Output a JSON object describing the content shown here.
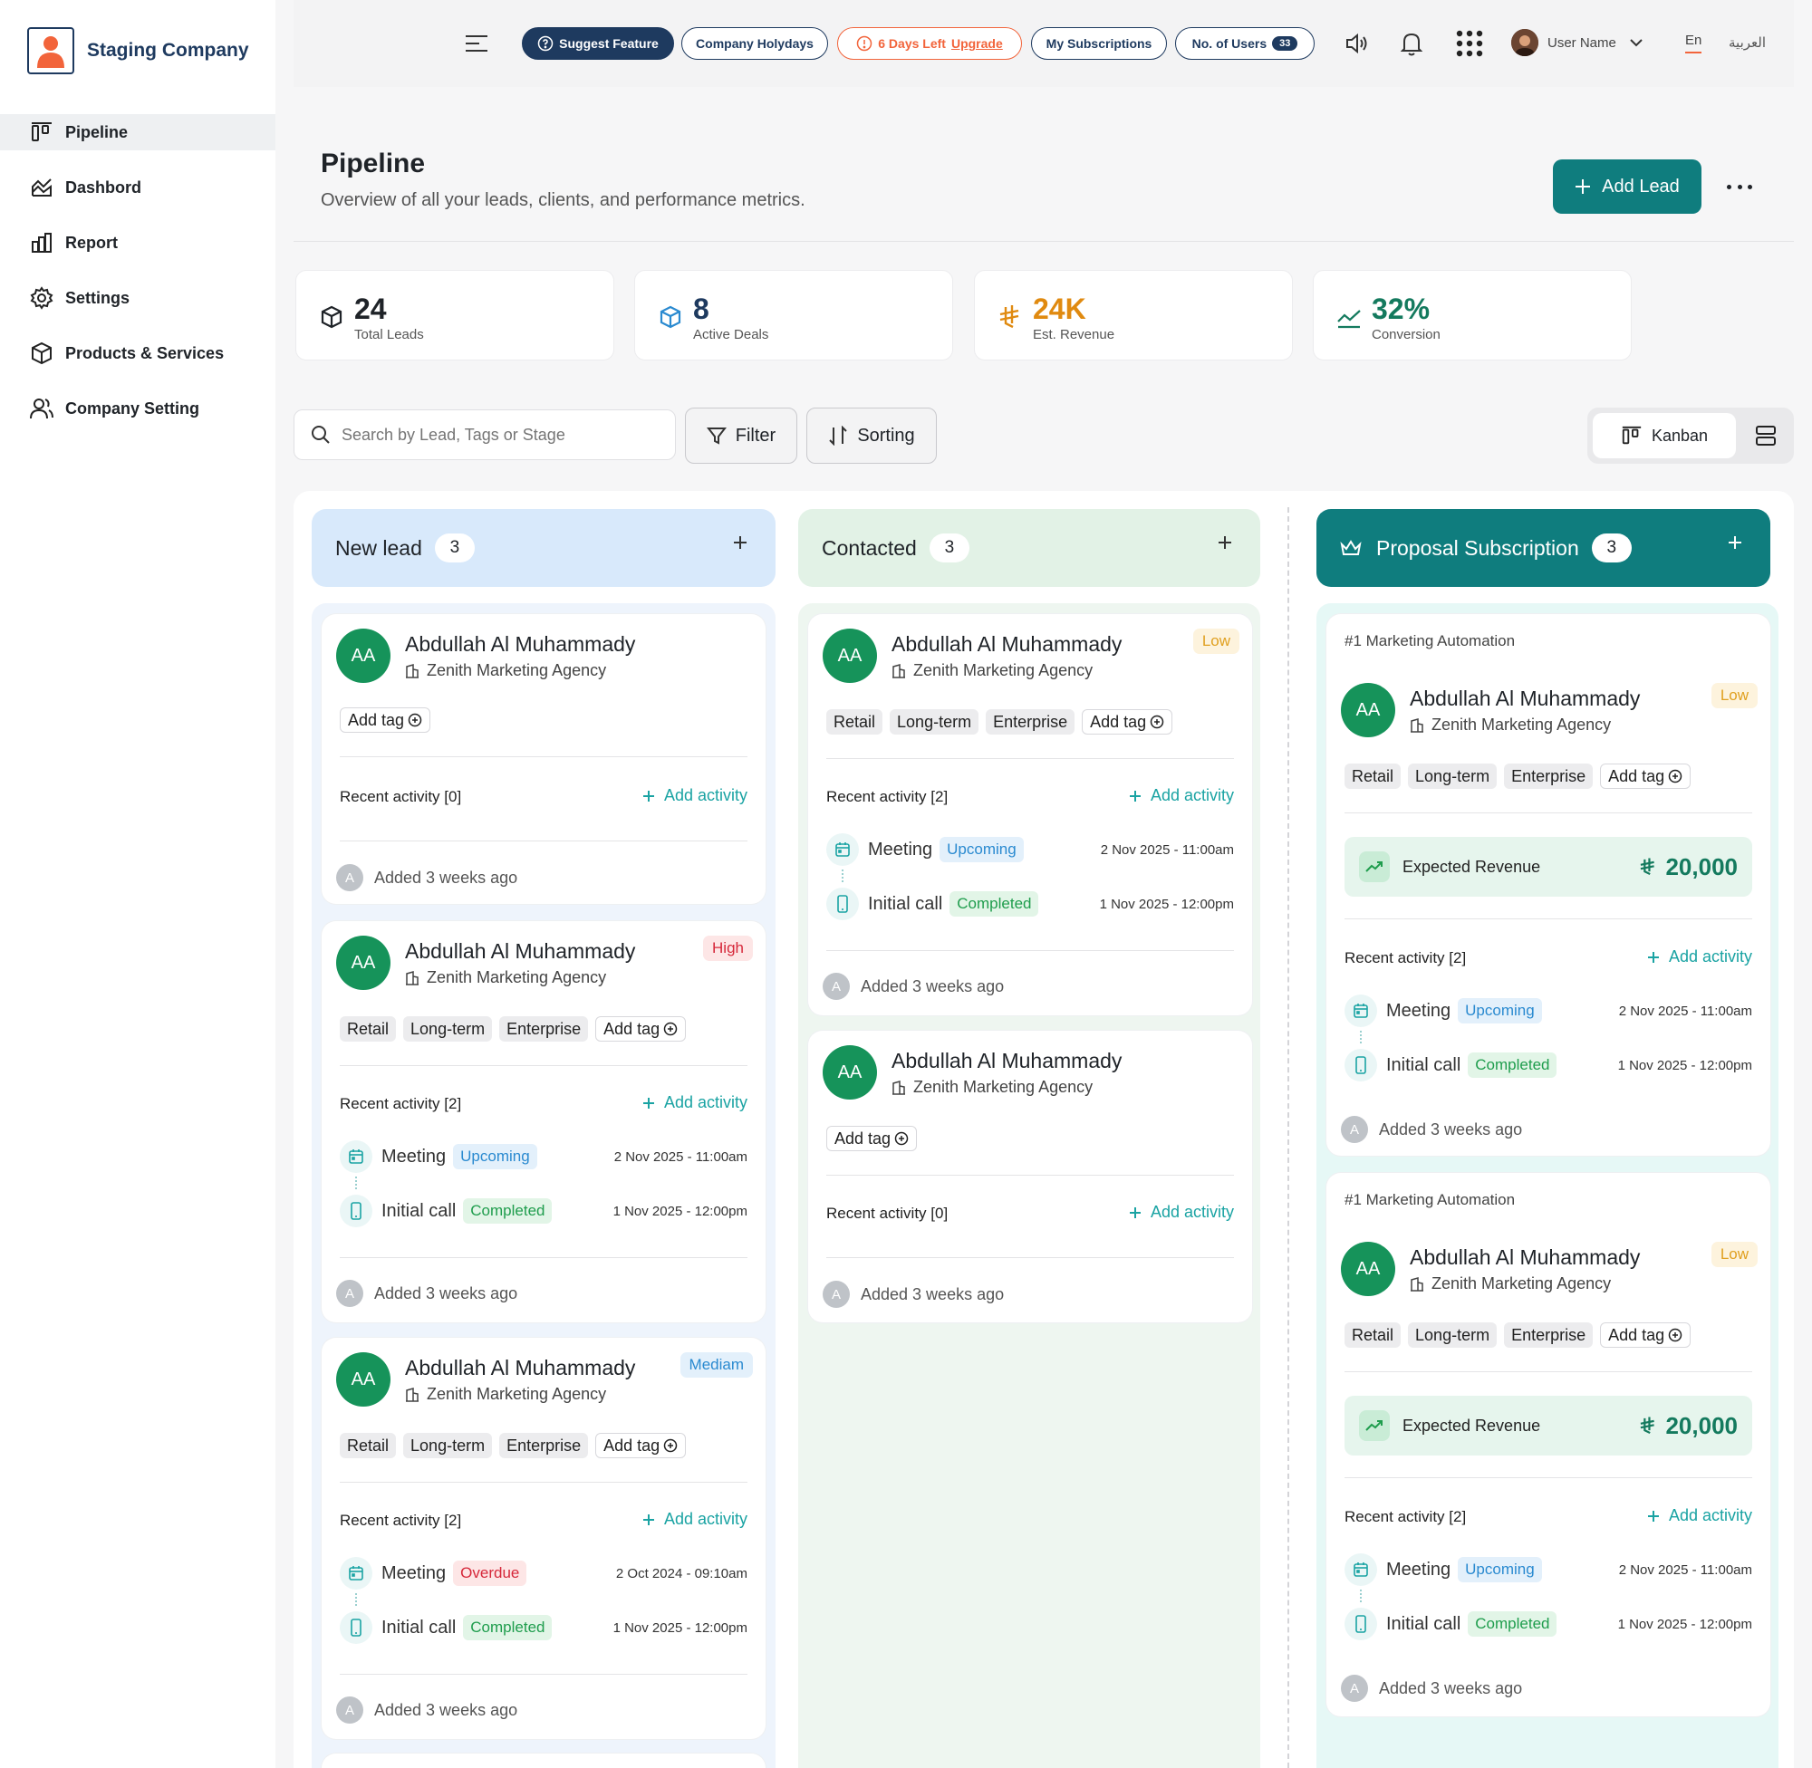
{
  "brand": {
    "name": "Staging Company"
  },
  "nav": [
    {
      "label": "Pipeline",
      "icon": "kanban-icon"
    },
    {
      "label": "Dashbord",
      "icon": "chart-area-icon"
    },
    {
      "label": "Report",
      "icon": "bar-chart-icon"
    },
    {
      "label": "Settings",
      "icon": "gear-icon"
    },
    {
      "label": "Products & Services",
      "icon": "box-icon"
    },
    {
      "label": "Company Setting",
      "icon": "users-icon"
    }
  ],
  "topbar": {
    "suggest": "Suggest Feature",
    "holidays": "Company Holydays",
    "trial": "6 Days Left",
    "upgrade": "Upgrade",
    "subs": "My Subscriptions",
    "users_label": "No. of Users",
    "users_count": "33",
    "user_name": "User Name",
    "lang_en": "En",
    "lang_ar": "العربية"
  },
  "header": {
    "title": "Pipeline",
    "subtitle": "Overview of all your leads, clients, and performance metrics.",
    "add_lead": "Add Lead"
  },
  "stats": [
    {
      "value": "24",
      "label": "Total Leads",
      "color": "#1f2328"
    },
    {
      "value": "8",
      "label": "Active Deals",
      "color": "#1e3a5f"
    },
    {
      "value": "24K",
      "label": "Est. Revenue",
      "color": "#e08a10"
    },
    {
      "value": "32%",
      "label": "Conversion",
      "color": "#147a5e"
    }
  ],
  "toolbar": {
    "search_placeholder": "Search by Lead, Tags or Stage",
    "filter": "Filter",
    "sorting": "Sorting",
    "kanban": "Kanban"
  },
  "columns": [
    {
      "title": "New lead",
      "count": "3",
      "color": "#d8e9fb"
    },
    {
      "title": "Contacted",
      "count": "3",
      "color": "#e2f2e6"
    },
    {
      "title": "Proposal Subscription",
      "count": "3",
      "color": "#0f7d7e"
    }
  ],
  "common": {
    "initials": "AA",
    "lead_name": "Abdullah Al Muhammady",
    "company": "Zenith Marketing Agency",
    "add_tag": "Add tag",
    "add_activity": "Add activity",
    "added": "Added 3 weeks ago",
    "added_initial": "A",
    "tags": [
      "Retail",
      "Long-term",
      "Enterprise"
    ],
    "ra0": "Recent activity [0]",
    "ra2": "Recent activity [2]",
    "meeting": "Meeting",
    "initial_call": "Initial call",
    "upcoming": "Upcoming",
    "completed": "Completed",
    "overdue": "Overdue",
    "d1": "2 Nov 2025 - 11:00am",
    "d2": "1 Nov 2025 - 12:00pm",
    "d3": "2 Oct 2024 - 09:10am",
    "low": "Low",
    "high": "High",
    "medium": "Mediam",
    "ref": "#1 Marketing Automation",
    "exp_label": "Expected Revenue",
    "exp_value": "20,000"
  }
}
